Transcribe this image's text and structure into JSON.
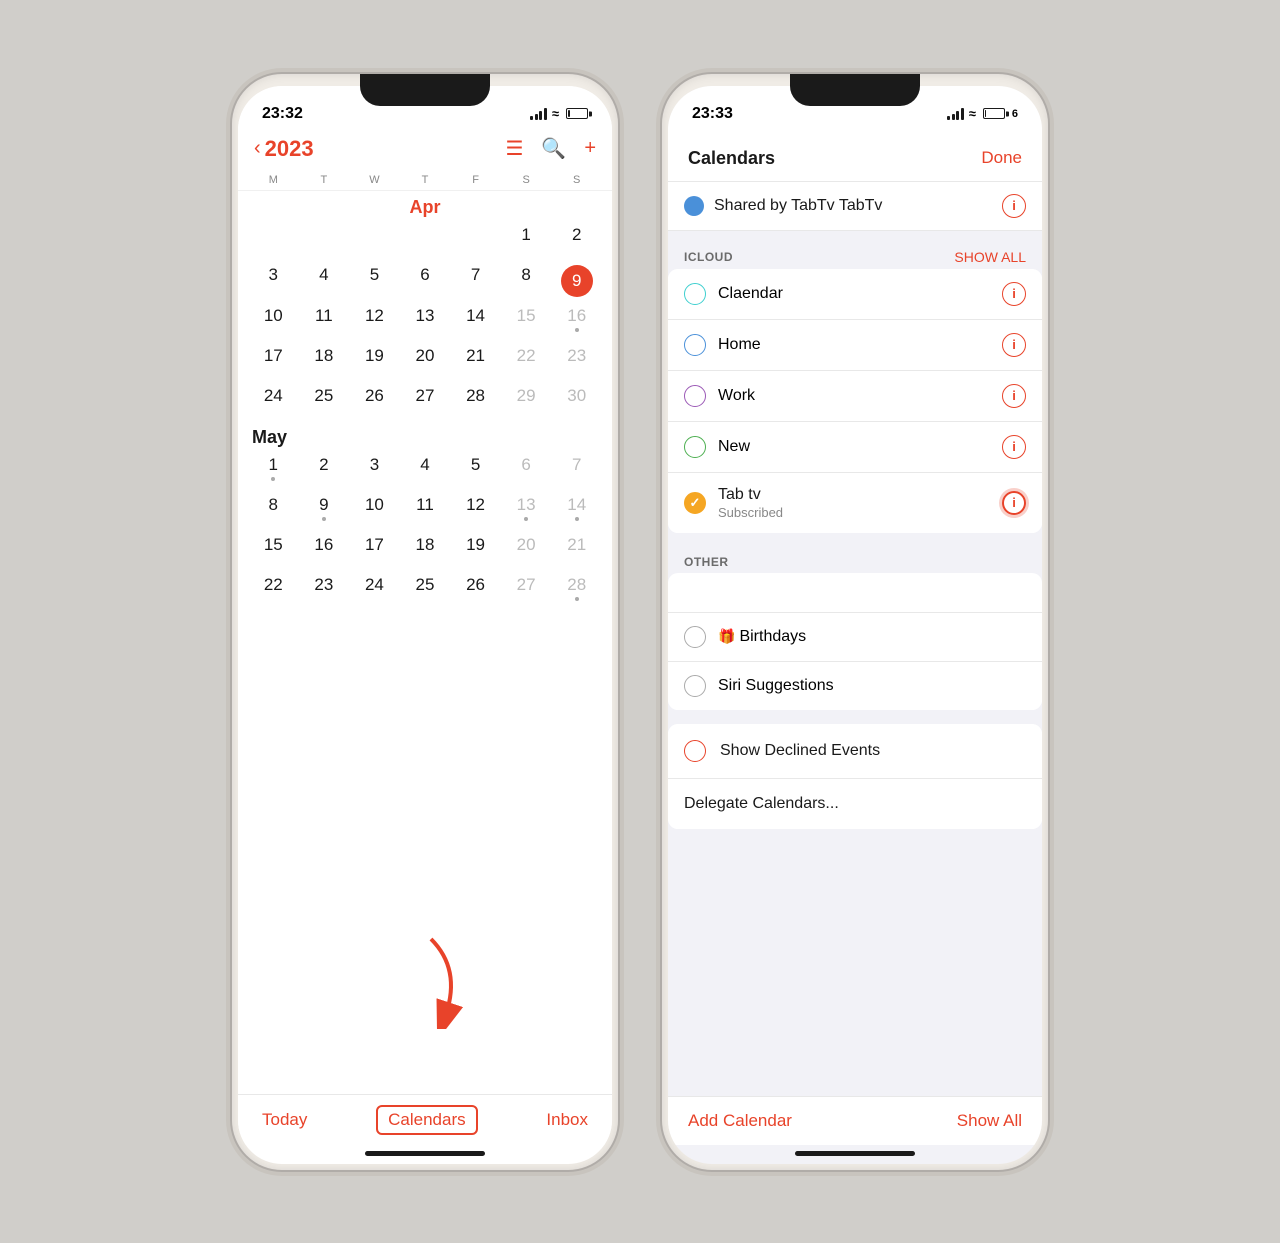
{
  "left_phone": {
    "status": {
      "time": "23:32",
      "battery": 7
    },
    "header": {
      "year": "2023",
      "chevron": "‹"
    },
    "weekdays": [
      "M",
      "T",
      "W",
      "T",
      "F",
      "S",
      "S"
    ],
    "months": [
      {
        "label": "Apr",
        "is_red": true,
        "weeks": [
          [
            {
              "day": "",
              "gray": false,
              "today": false,
              "dot": false
            },
            {
              "day": "",
              "gray": false,
              "today": false,
              "dot": false
            },
            {
              "day": "",
              "gray": false,
              "today": false,
              "dot": false
            },
            {
              "day": "",
              "gray": false,
              "today": false,
              "dot": false
            },
            {
              "day": "",
              "gray": false,
              "today": false,
              "dot": false
            },
            {
              "day": "1",
              "gray": false,
              "today": false,
              "dot": false
            },
            {
              "day": "2",
              "gray": false,
              "today": false,
              "dot": false
            }
          ],
          [
            {
              "day": "3",
              "gray": false,
              "today": false,
              "dot": false
            },
            {
              "day": "4",
              "gray": false,
              "today": false,
              "dot": false
            },
            {
              "day": "5",
              "gray": false,
              "today": false,
              "dot": false
            },
            {
              "day": "6",
              "gray": false,
              "today": false,
              "dot": false
            },
            {
              "day": "7",
              "gray": false,
              "today": false,
              "dot": false
            },
            {
              "day": "8",
              "gray": false,
              "today": false,
              "dot": false
            },
            {
              "day": "9",
              "gray": false,
              "today": true,
              "dot": false
            }
          ],
          [
            {
              "day": "10",
              "gray": false,
              "today": false,
              "dot": false
            },
            {
              "day": "11",
              "gray": false,
              "today": false,
              "dot": false
            },
            {
              "day": "12",
              "gray": false,
              "today": false,
              "dot": false
            },
            {
              "day": "13",
              "gray": false,
              "today": false,
              "dot": false
            },
            {
              "day": "14",
              "gray": false,
              "today": false,
              "dot": false
            },
            {
              "day": "15",
              "gray": true,
              "today": false,
              "dot": false
            },
            {
              "day": "16",
              "gray": true,
              "today": false,
              "dot": true
            }
          ],
          [
            {
              "day": "17",
              "gray": false,
              "today": false,
              "dot": false
            },
            {
              "day": "18",
              "gray": false,
              "today": false,
              "dot": false
            },
            {
              "day": "19",
              "gray": false,
              "today": false,
              "dot": false
            },
            {
              "day": "20",
              "gray": false,
              "today": false,
              "dot": false
            },
            {
              "day": "21",
              "gray": false,
              "today": false,
              "dot": false
            },
            {
              "day": "22",
              "gray": true,
              "today": false,
              "dot": false
            },
            {
              "day": "23",
              "gray": true,
              "today": false,
              "dot": false
            }
          ],
          [
            {
              "day": "24",
              "gray": false,
              "today": false,
              "dot": false
            },
            {
              "day": "25",
              "gray": false,
              "today": false,
              "dot": false
            },
            {
              "day": "26",
              "gray": false,
              "today": false,
              "dot": false
            },
            {
              "day": "27",
              "gray": false,
              "today": false,
              "dot": false
            },
            {
              "day": "28",
              "gray": false,
              "today": false,
              "dot": false
            },
            {
              "day": "29",
              "gray": true,
              "today": false,
              "dot": false
            },
            {
              "day": "30",
              "gray": true,
              "today": false,
              "dot": false
            }
          ]
        ]
      },
      {
        "label": "May",
        "is_red": false,
        "weeks": [
          [
            {
              "day": "1",
              "gray": false,
              "today": false,
              "dot": false
            },
            {
              "day": "2",
              "gray": false,
              "today": false,
              "dot": false
            },
            {
              "day": "3",
              "gray": false,
              "today": false,
              "dot": false
            },
            {
              "day": "4",
              "gray": false,
              "today": false,
              "dot": false
            },
            {
              "day": "5",
              "gray": false,
              "today": false,
              "dot": false
            },
            {
              "day": "6",
              "gray": true,
              "today": false,
              "dot": false
            },
            {
              "day": "7",
              "gray": true,
              "today": false,
              "dot": false
            }
          ],
          [
            {
              "day": "8",
              "gray": false,
              "today": false,
              "dot": false
            },
            {
              "day": "9",
              "gray": false,
              "today": false,
              "dot": true
            },
            {
              "day": "10",
              "gray": false,
              "today": false,
              "dot": false
            },
            {
              "day": "11",
              "gray": false,
              "today": false,
              "dot": false
            },
            {
              "day": "12",
              "gray": false,
              "today": false,
              "dot": false
            },
            {
              "day": "13",
              "gray": true,
              "today": false,
              "dot": true
            },
            {
              "day": "14",
              "gray": true,
              "today": false,
              "dot": true
            }
          ],
          [
            {
              "day": "15",
              "gray": false,
              "today": false,
              "dot": false
            },
            {
              "day": "16",
              "gray": false,
              "today": false,
              "dot": false
            },
            {
              "day": "17",
              "gray": false,
              "today": false,
              "dot": false
            },
            {
              "day": "18",
              "gray": false,
              "today": false,
              "dot": false
            },
            {
              "day": "19",
              "gray": false,
              "today": false,
              "dot": false
            },
            {
              "day": "20",
              "gray": true,
              "today": false,
              "dot": false
            },
            {
              "day": "21",
              "gray": true,
              "today": false,
              "dot": false
            }
          ],
          [
            {
              "day": "22",
              "gray": false,
              "today": false,
              "dot": false
            },
            {
              "day": "23",
              "gray": false,
              "today": false,
              "dot": false
            },
            {
              "day": "24",
              "gray": false,
              "today": false,
              "dot": false
            },
            {
              "day": "25",
              "gray": false,
              "today": false,
              "dot": false
            },
            {
              "day": "26",
              "gray": false,
              "today": false,
              "dot": false
            },
            {
              "day": "27",
              "gray": true,
              "today": false,
              "dot": false
            },
            {
              "day": "28",
              "gray": true,
              "today": false,
              "dot": true
            }
          ]
        ]
      }
    ],
    "footer": {
      "today": "Today",
      "calendars": "Calendars",
      "inbox": "Inbox"
    }
  },
  "right_phone": {
    "status": {
      "time": "23:33",
      "battery": 6
    },
    "header": {
      "title": "Calendars",
      "done": "Done"
    },
    "shared_item": {
      "name": "Shared by TabTv TabTv",
      "color": "blue"
    },
    "icloud_section": {
      "label": "ICLOUD",
      "show_all": "SHOW ALL",
      "items": [
        {
          "name": "Claendar",
          "color": "cyan",
          "checked": false
        },
        {
          "name": "Home",
          "color": "blue",
          "checked": false
        },
        {
          "name": "Work",
          "color": "purple",
          "checked": false
        },
        {
          "name": "New",
          "color": "green",
          "checked": false
        },
        {
          "name": "Tab tv",
          "color": "orange",
          "checked": true,
          "sub": "Subscribed",
          "highlighted": true
        }
      ]
    },
    "other_section": {
      "label": "OTHER",
      "items": [
        {
          "name": "Birthdays",
          "icon": "🎁",
          "color": "gray",
          "checked": false
        },
        {
          "name": "Siri Suggestions",
          "color": "gray",
          "checked": false
        }
      ]
    },
    "show_declined": {
      "label": "Show Declined Events",
      "color": "red",
      "checked": false
    },
    "delegate": "Delegate Calendars...",
    "footer": {
      "add_calendar": "Add Calendar",
      "show_all": "Show All"
    }
  }
}
